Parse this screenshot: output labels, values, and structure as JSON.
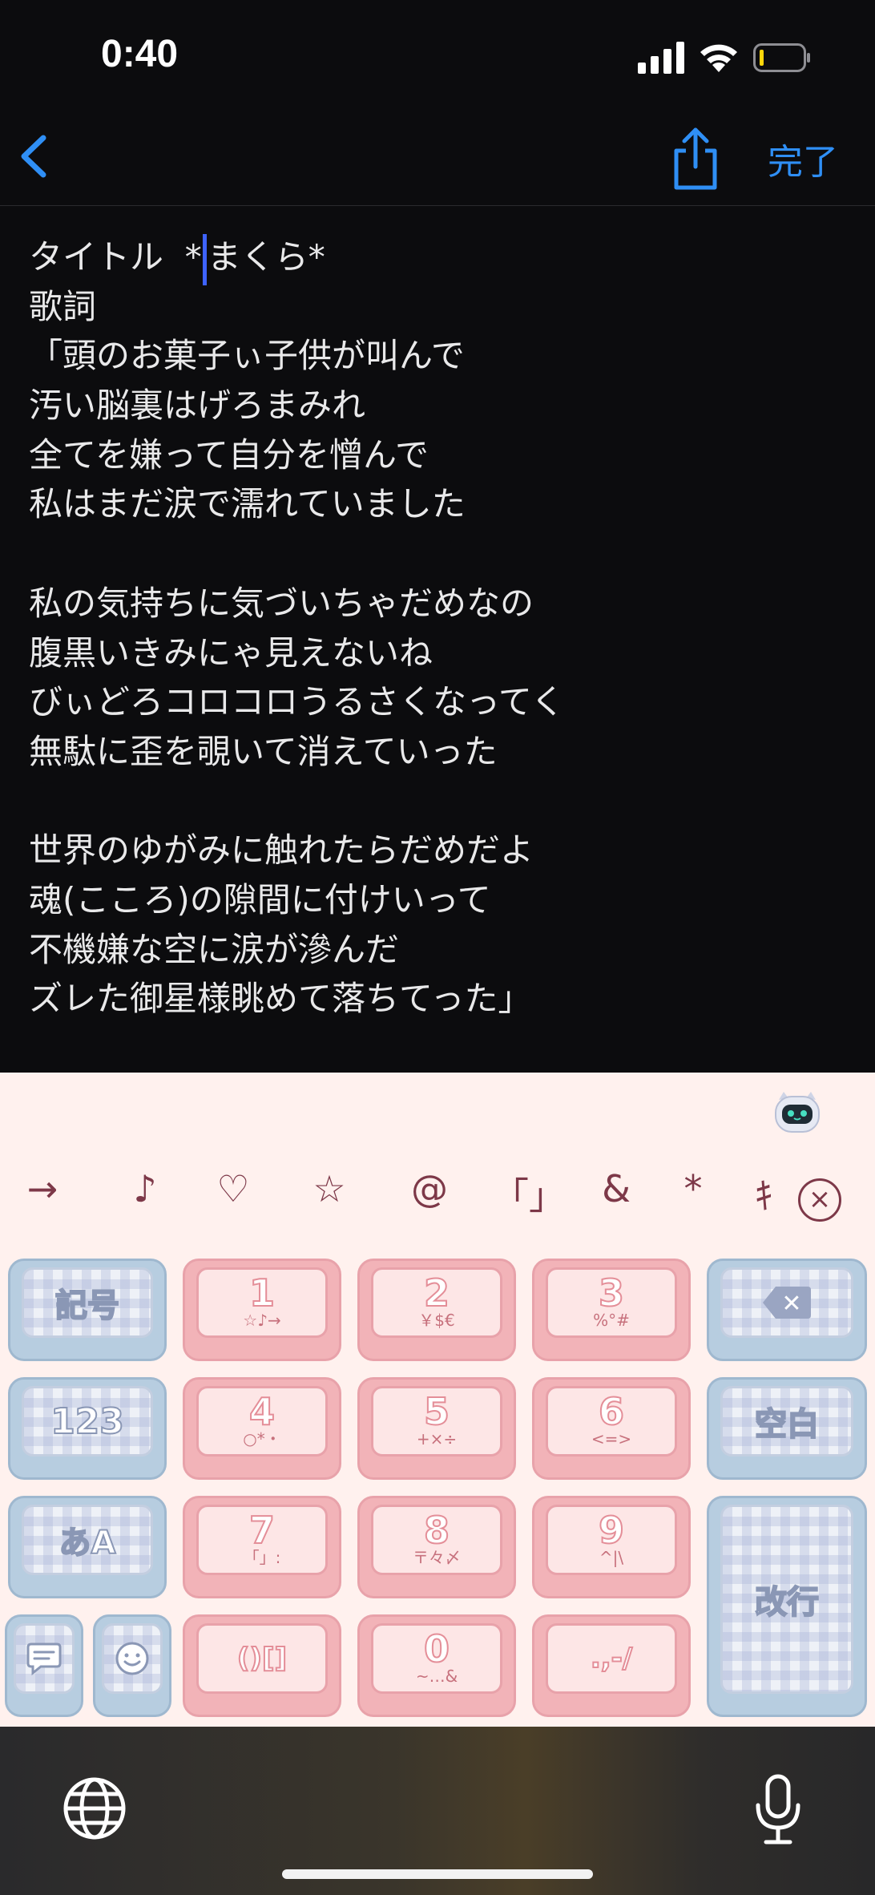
{
  "status_bar": {
    "time": "0:40"
  },
  "nav": {
    "done_label": "完了"
  },
  "note": {
    "lines": [
      "タイトル  *",
      "歌詞",
      "「頭のお菓子ぃ子供が叫んで",
      "汚い脳裏はげろまみれ",
      "全てを嫌って自分を憎んで",
      "私はまだ涙で濡れていました",
      "",
      "私の気持ちに気づいちゃだめなの",
      "腹黒いきみにゃ見えないね",
      "びぃどろコロコロうるさくなってく",
      "無駄に歪を覗いて消えていった",
      "",
      "世界のゆがみに触れたらだめだよ",
      "魂(こころ)の隙間に付けいって",
      "不機嫌な空に涙が滲んだ",
      "ズレた御星様眺めて落ちてった」"
    ],
    "title_after_caret": "まくら*"
  },
  "keyboard": {
    "candidates": [
      "→",
      "♪",
      "♡",
      "☆",
      "@",
      "「」",
      "&",
      "*",
      "ｷ"
    ],
    "candidates_close": "×",
    "keys": {
      "symbols": "記号",
      "k1": "1",
      "k1_sub": "☆♪→",
      "k2": "2",
      "k2_sub": "￥$€",
      "k3": "3",
      "k3_sub": "%°#",
      "delete": "✕",
      "numbers": "123",
      "k4": "4",
      "k4_sub": "○*・",
      "k5": "5",
      "k5_sub": "+×÷",
      "k6": "6",
      "k6_sub": "<=>",
      "space": "空白",
      "kana": "あA",
      "k7": "7",
      "k7_sub": "「」:",
      "k8": "8",
      "k8_sub": "〒々〆",
      "k9": "9",
      "k9_sub": "^|\\",
      "enter": "改行",
      "brackets": "()[]",
      "k0": "0",
      "k0_sub": "~…&",
      "punct": ".,-/"
    }
  }
}
